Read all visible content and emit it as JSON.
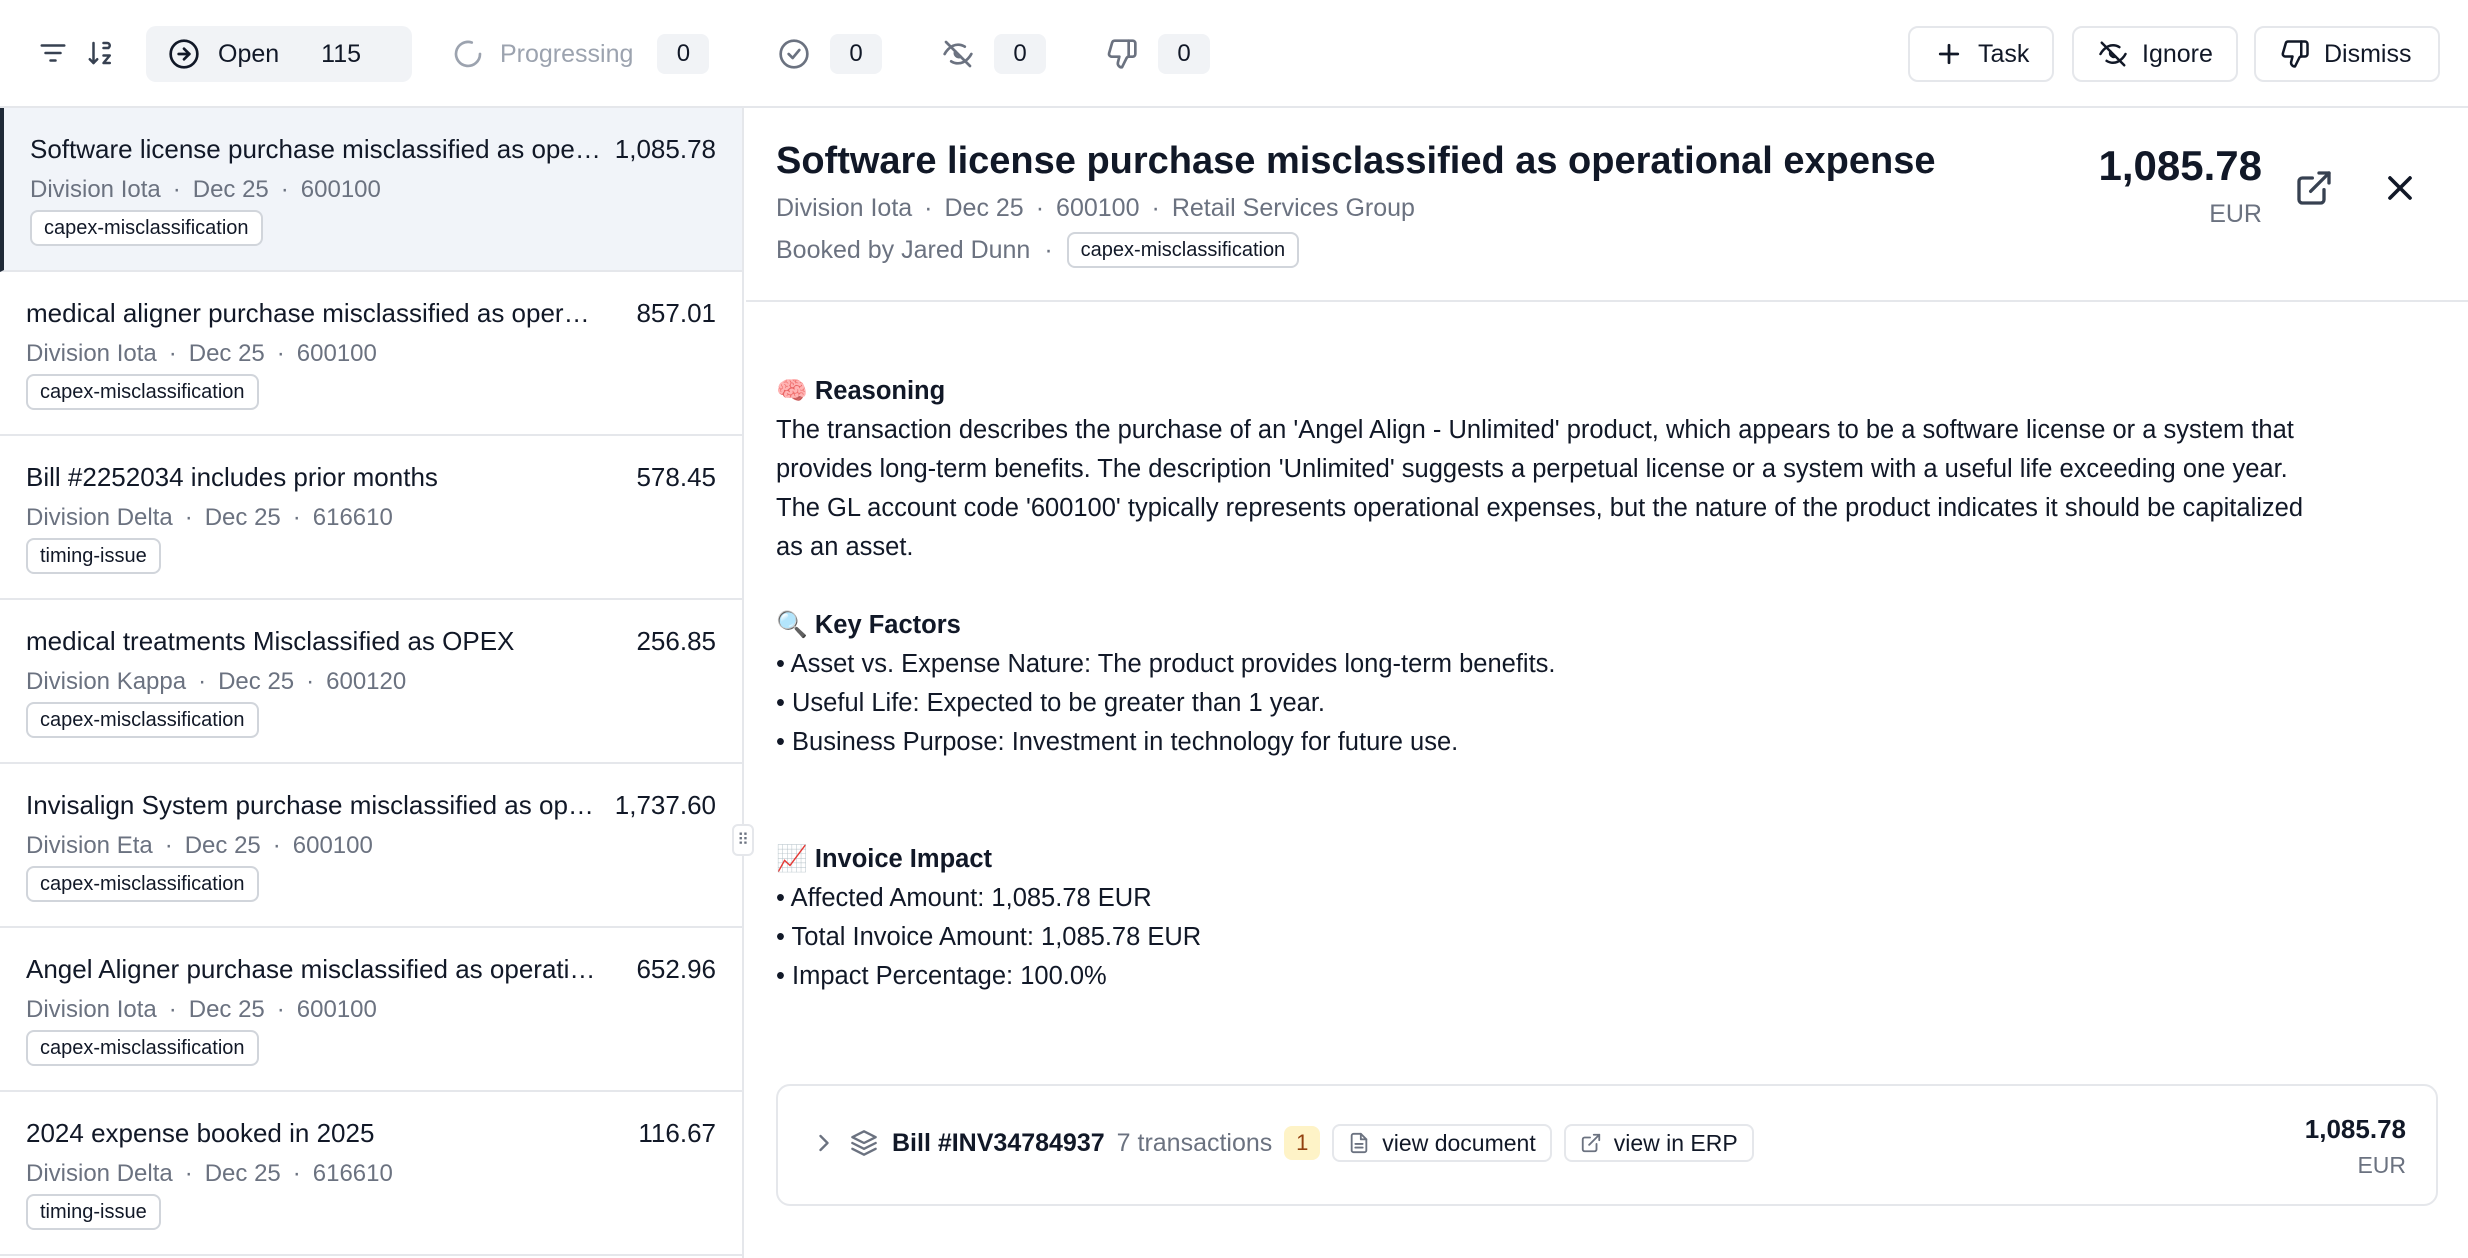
{
  "toolbar": {
    "filter_icon": "filter-icon",
    "sort_icon": "sort-icon",
    "statuses": [
      {
        "label": "Open",
        "count": "115",
        "icon": "arrow-right-circle-icon"
      },
      {
        "label": "Progressing",
        "count": "0",
        "icon": "loader-icon"
      },
      {
        "label": "",
        "count": "0",
        "icon": "check-circle-icon"
      },
      {
        "label": "",
        "count": "0",
        "icon": "eye-off-icon"
      },
      {
        "label": "",
        "count": "0",
        "icon": "thumbs-down-icon"
      }
    ],
    "actions": {
      "task": "Task",
      "ignore": "Ignore",
      "dismiss": "Dismiss"
    }
  },
  "list": [
    {
      "title": "Software license purchase misclassified as operational expense",
      "amount": "1,085.78",
      "division": "Division Iota",
      "date": "Dec 25",
      "account": "600100",
      "tag": "capex-misclassification",
      "selected": true
    },
    {
      "title": "medical aligner purchase misclassified as operational expense",
      "amount": "857.01",
      "division": "Division Iota",
      "date": "Dec 25",
      "account": "600100",
      "tag": "capex-misclassification"
    },
    {
      "title": "Bill #2252034 includes prior months",
      "amount": "578.45",
      "division": "Division Delta",
      "date": "Dec 25",
      "account": "616610",
      "tag": "timing-issue"
    },
    {
      "title": "medical treatments Misclassified as OPEX",
      "amount": "256.85",
      "division": "Division Kappa",
      "date": "Dec 25",
      "account": "600120",
      "tag": "capex-misclassification"
    },
    {
      "title": "Invisalign System purchase misclassified as operational expense",
      "amount": "1,737.60",
      "division": "Division Eta",
      "date": "Dec 25",
      "account": "600100",
      "tag": "capex-misclassification"
    },
    {
      "title": "Angel Aligner purchase misclassified as operational expense",
      "amount": "652.96",
      "division": "Division Iota",
      "date": "Dec 25",
      "account": "600100",
      "tag": "capex-misclassification"
    },
    {
      "title": "2024 expense booked in 2025",
      "amount": "116.67",
      "division": "Division Delta",
      "date": "Dec 25",
      "account": "616610",
      "tag": "timing-issue"
    }
  ],
  "detail": {
    "title": "Software license purchase misclassified as operational expense",
    "division": "Division Iota",
    "date": "Dec 25",
    "account": "600100",
    "group": "Retail Services Group",
    "booked_by": "Booked by Jared Dunn",
    "tag": "capex-misclassification",
    "amount": "1,085.78",
    "currency": "EUR",
    "reasoning": {
      "emoji": "🧠",
      "title": "Reasoning",
      "lines": [
        "The transaction describes the purchase of an 'Angel Align - Unlimited' product, which appears to be a software license or a system that",
        "provides long-term benefits. The description 'Unlimited' suggests a perpetual license or a system with a useful life exceeding one year.",
        "The GL account code '600100' typically represents operational expenses, but the nature of the product indicates it should be capitalized",
        "as an asset."
      ]
    },
    "key_factors": {
      "emoji": "🔍",
      "title": "Key Factors",
      "items": [
        "• Asset vs. Expense Nature: The product provides long-term benefits.",
        "• Useful Life: Expected to be greater than 1 year.",
        "• Business Purpose: Investment in technology for future use."
      ]
    },
    "invoice_impact": {
      "emoji": "📈",
      "title": "Invoice Impact",
      "items": [
        "• Affected Amount: 1,085.78 EUR",
        "• Total Invoice Amount: 1,085.78 EUR",
        "• Impact Percentage: 100.0%"
      ]
    },
    "bill": {
      "name": "Bill #INV34784937",
      "transactions": "7 transactions",
      "badge": "1",
      "view_document": "view document",
      "view_erp": "view in ERP",
      "amount": "1,085.78",
      "currency": "EUR"
    }
  }
}
